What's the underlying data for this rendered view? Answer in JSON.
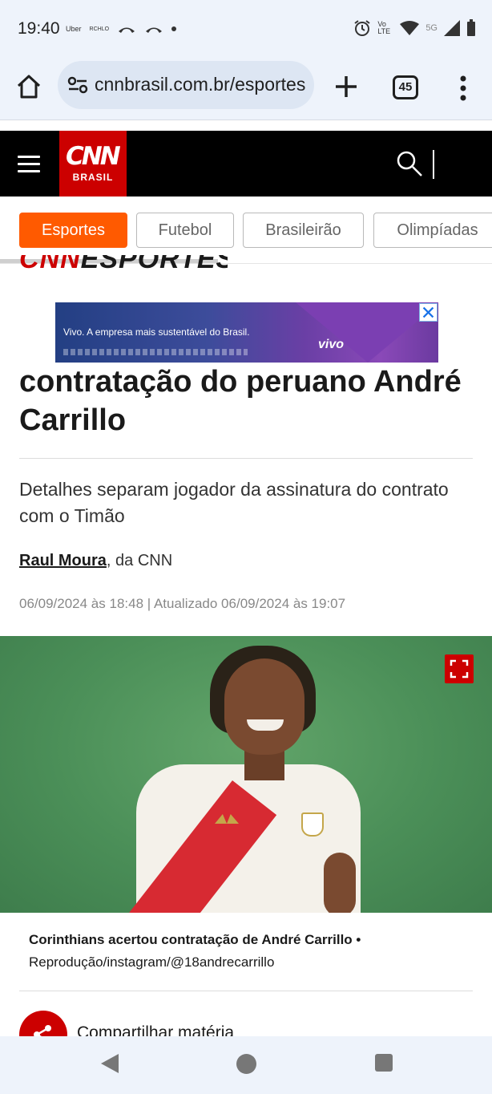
{
  "status_bar": {
    "time": "19:40",
    "app_icons": [
      "Uber",
      "RCHLO"
    ],
    "network": "5G",
    "volte": "Vo LTE"
  },
  "browser": {
    "url": "cnnbrasil.com.br/esportes",
    "tab_count": "45"
  },
  "header": {
    "logo_top": "CNN",
    "logo_bottom": "BRASIL"
  },
  "categories": [
    {
      "label": "Esportes",
      "active": true
    },
    {
      "label": "Futebol",
      "active": false
    },
    {
      "label": "Brasileirão",
      "active": false
    },
    {
      "label": "Olimpíadas",
      "active": false
    }
  ],
  "section": {
    "logo_a": "CNN",
    "logo_b": "ESPORTES"
  },
  "ad": {
    "text": "Vivo. A empresa mais sustentável do Brasil.",
    "brand": "vivo"
  },
  "article": {
    "headline": "contratação do peruano André Carrillo",
    "subtitle": "Detalhes separam jogador da assinatura do contrato com o Timão",
    "author": "Raul Moura",
    "byline_suffix": ", da CNN",
    "dates": "06/09/2024 às 18:48 | Atualizado 06/09/2024 às 19:07",
    "caption_main": "Corinthians acertou contratação de André Carrillo •",
    "caption_credit": "Reprodução/instagram/@18andrecarrillo",
    "share_label": "Compartilhar matéria"
  },
  "colors": {
    "accent_orange": "#ff5a00",
    "cnn_red": "#cc0000",
    "header_black": "#000000"
  }
}
